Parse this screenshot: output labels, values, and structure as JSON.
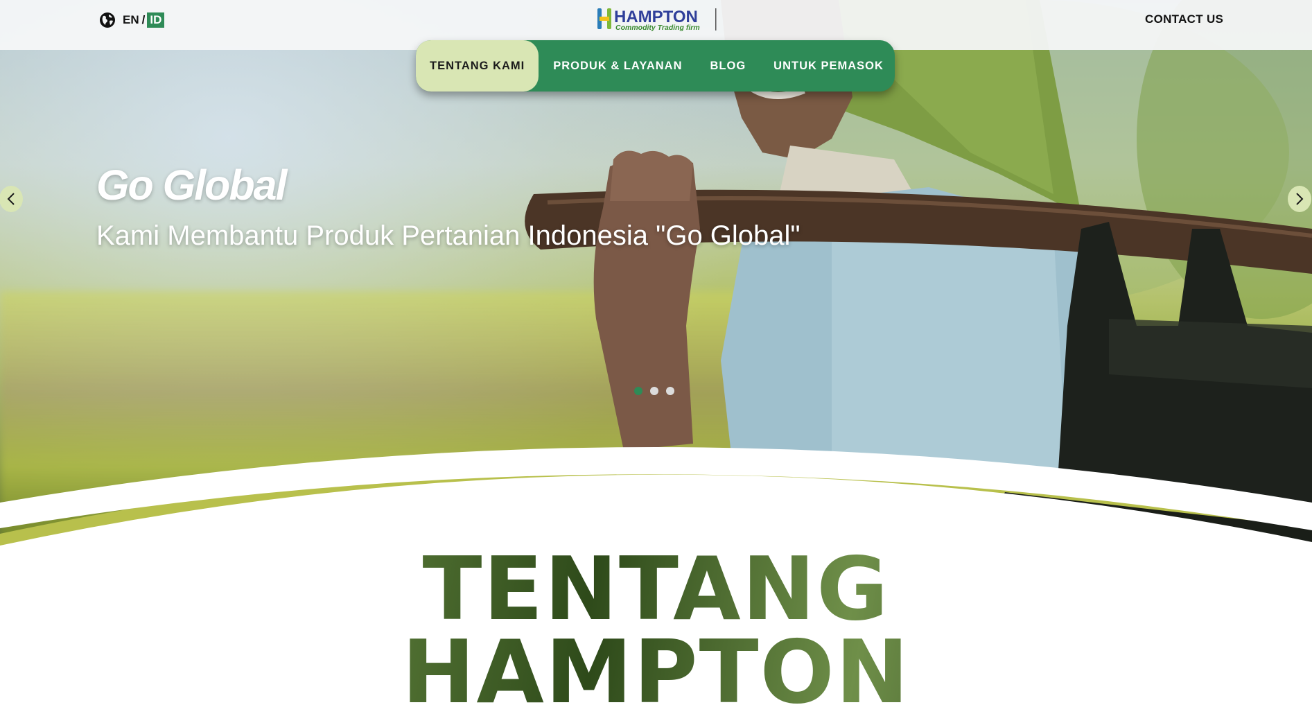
{
  "language": {
    "en": "EN",
    "separator": "/",
    "id": "ID"
  },
  "logo": {
    "name": "HAMPTON",
    "tagline": "Commodity Trading firm"
  },
  "header": {
    "contact_label": "CONTACT US"
  },
  "nav": {
    "items": [
      {
        "label": "TENTANG KAMI",
        "active": true
      },
      {
        "label": "PRODUK & LAYANAN",
        "active": false
      },
      {
        "label": "BLOG",
        "active": false
      },
      {
        "label": "UNTUK PEMASOK",
        "active": false
      }
    ]
  },
  "hero": {
    "title": "Go Global",
    "subtitle": "Kami Membantu Produk Pertanian Indonesia \"Go Global\"",
    "slides_total": 3,
    "active_slide": 1
  },
  "section": {
    "title_line1": "TENTANG",
    "title_line2": "HAMPTON"
  },
  "colors": {
    "brand_green": "#2e8b57",
    "nav_active_bg": "#d9e6b4",
    "arrow_bg": "#d9e6b4"
  },
  "icons": {
    "globe": "globe-icon",
    "prev": "chevron-left-icon",
    "next": "chevron-right-icon"
  }
}
